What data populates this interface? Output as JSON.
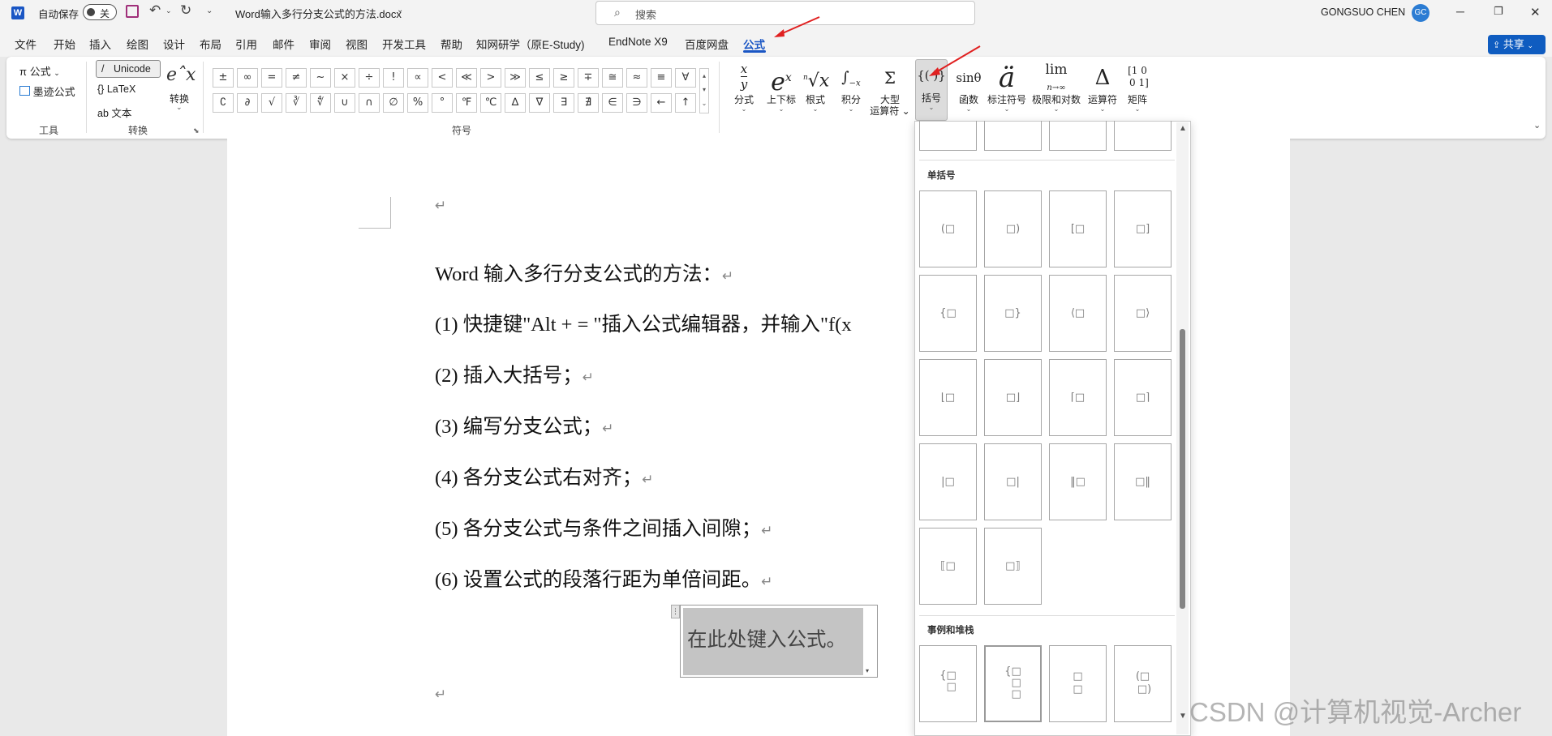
{
  "titlebar": {
    "app_icon": "W",
    "autosave_label": "自动保存",
    "autosave_state": "关",
    "filename": "Word输入多行分支公式的方法.docx",
    "search_placeholder": "搜索",
    "user_name": "GONGSUO CHEN",
    "avatar_initials": "GC"
  },
  "menu": {
    "items": [
      "文件",
      "开始",
      "插入",
      "绘图",
      "设计",
      "布局",
      "引用",
      "邮件",
      "审阅",
      "视图",
      "开发工具",
      "帮助",
      "知网研学（原E-Study)",
      "EndNote X9",
      "百度网盘",
      "公式"
    ],
    "active": "公式",
    "share_label": "共享"
  },
  "ribbon": {
    "tools": {
      "equation": "公式",
      "ink_equation": "墨迹公式",
      "group": "工具"
    },
    "convert": {
      "unicode": "Unicode",
      "latex": "LaTeX",
      "text": "文本",
      "convert_btn": "转换",
      "group": "转换"
    },
    "symbols": {
      "row1": [
        "±",
        "∞",
        "=",
        "≠",
        "~",
        "×",
        "÷",
        "!",
        "∝",
        "<",
        "≪",
        ">",
        "≫",
        "≤",
        "≥",
        "∓",
        "≅",
        "≈",
        "≡",
        "∀"
      ],
      "row2": [
        "∁",
        "∂",
        "√",
        "∛",
        "∜",
        "∪",
        "∩",
        "∅",
        "%",
        "°",
        "℉",
        "℃",
        "∆",
        "∇",
        "∃",
        "∄",
        "∈",
        "∋",
        "←",
        "↑"
      ],
      "group": "符号"
    },
    "structures": [
      {
        "glyph": "x/y",
        "label": "分式"
      },
      {
        "glyph": "eˣ",
        "label": "上下标"
      },
      {
        "glyph": "ⁿ√x",
        "label": "根式"
      },
      {
        "glyph": "∫",
        "label": "积分"
      },
      {
        "glyph": "Σ",
        "label": "大型\n运算符"
      },
      {
        "glyph": "{()}",
        "label": "括号"
      },
      {
        "glyph": "sinθ",
        "label": "函数"
      },
      {
        "glyph": "ä",
        "label": "标注符号"
      },
      {
        "glyph": "lim",
        "label": "极限和对数"
      },
      {
        "glyph": "Δ",
        "label": "运算符"
      },
      {
        "glyph": "[10;01]",
        "label": "矩阵"
      }
    ]
  },
  "document": {
    "lines": [
      "Word 输入多行分支公式的方法：",
      "(1) 快捷键\"Alt + = \"插入公式编辑器，并输入\"f(x",
      "(2) 插入大括号；",
      "(3) 编写分支公式；",
      "(4) 各分支公式右对齐；",
      "(5) 各分支公式与条件之间插入间隙；",
      "(6) 设置公式的段落行距为单倍间距。"
    ],
    "para_mark": "↵",
    "equation_placeholder": "在此处键入公式。"
  },
  "bracket_panel": {
    "section_single": "单括号",
    "section_cases": "事例和堆栈",
    "single_items": [
      "(□",
      "□)",
      "[□",
      "□]",
      "{□",
      "□}",
      "⟨□",
      "□⟩",
      "⌊□",
      "□⌋",
      "⌈□",
      "□⌉",
      "|□",
      "□|",
      "‖□",
      "□‖",
      "⟦□",
      "□⟧"
    ],
    "cases_items": [
      "{□□",
      "{□□□",
      "□□",
      "(□□)"
    ]
  },
  "watermark": "CSDN @计算机视觉-Archer",
  "colors": {
    "accent": "#1a56c4",
    "annotation_arrow": "#e02020",
    "share_bg": "#0f5cc0"
  }
}
